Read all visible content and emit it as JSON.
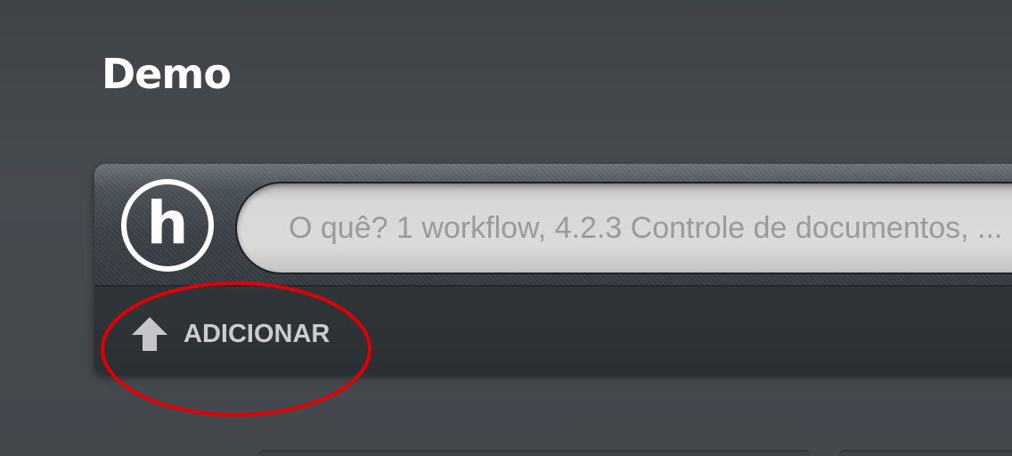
{
  "page": {
    "title": "Demo"
  },
  "header": {
    "logo_letter": "h",
    "logo_icon": "h-circle-logo-icon"
  },
  "search": {
    "placeholder": "O quê? 1 workflow, 4.2.3 Controle de documentos, ...",
    "value": ""
  },
  "toolbar": {
    "add_label": "ADICIONAR",
    "add_icon": "upload-arrow-icon"
  },
  "colors": {
    "background": "#44494e",
    "panel": "#2b3035",
    "search_field": "#d8d8d8",
    "highlight": "#e00000",
    "label_text": "#c9cbcd"
  }
}
